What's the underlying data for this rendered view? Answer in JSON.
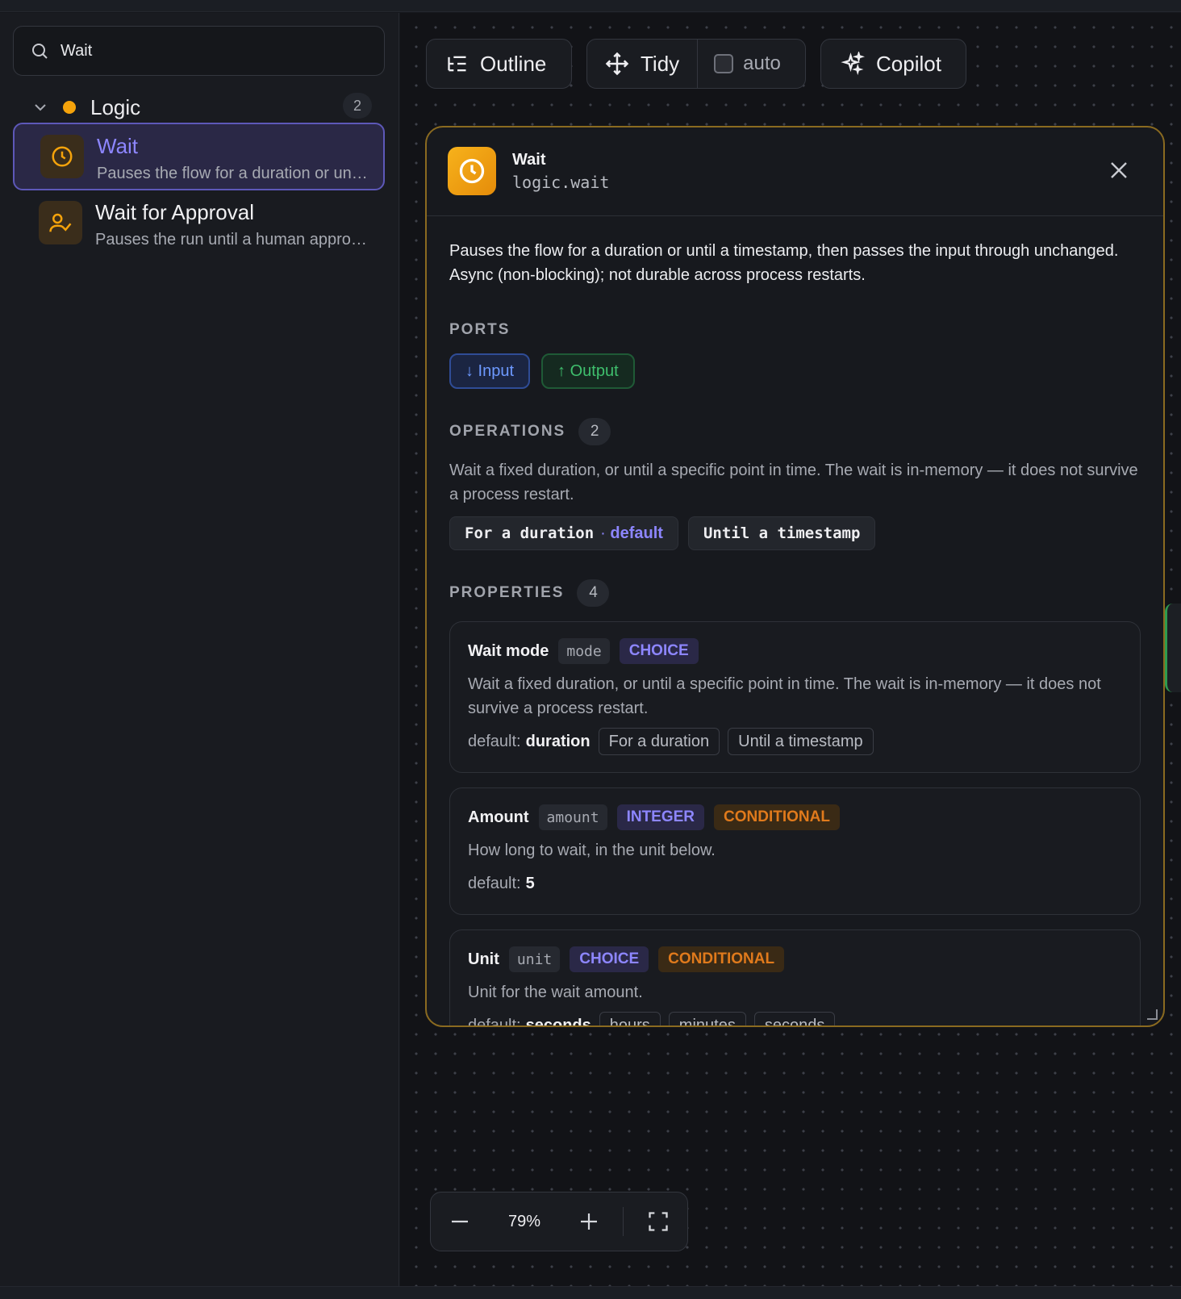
{
  "sidebar": {
    "search": {
      "value": "Wait",
      "placeholder": "Search"
    },
    "group": {
      "name": "Logic",
      "count": "2",
      "dot_color": "#f5a30b"
    },
    "items": [
      {
        "title": "Wait",
        "desc": "Pauses the flow for a duration or unt…",
        "icon": "clock-icon",
        "selected": true
      },
      {
        "title": "Wait for Approval",
        "desc": "Pauses the run until a human approv…",
        "icon": "user-check-icon",
        "selected": false
      }
    ]
  },
  "toolbar": {
    "outline": "Outline",
    "tidy": "Tidy",
    "auto": "auto",
    "copilot": "Copilot"
  },
  "panel": {
    "title": "Wait",
    "subtitle": "logic.wait",
    "description": "Pauses the flow for a duration or until a timestamp, then passes the input through unchanged. Async (non-blocking); not durable across process restarts.",
    "ports_label": "PORTS",
    "ports": {
      "input": "↓ Input",
      "output": "↑ Output"
    },
    "operations_label": "OPERATIONS",
    "operations_count": "2",
    "operations_desc": "Wait a fixed duration, or until a specific point in time. The wait is in-memory — it does not survive a process restart.",
    "operations": [
      {
        "label": "For a duration",
        "default": "default"
      },
      {
        "label": "Until a timestamp"
      }
    ],
    "properties_label": "PROPERTIES",
    "properties_count": "4",
    "properties": [
      {
        "name": "Wait mode",
        "key": "mode",
        "type": "CHOICE",
        "desc": "Wait a fixed duration, or until a specific point in time. The wait is in-memory — it does not survive a process restart.",
        "default_label": "default:",
        "default_value": "duration",
        "options": [
          "For a duration",
          "Until a timestamp"
        ]
      },
      {
        "name": "Amount",
        "key": "amount",
        "type": "INTEGER",
        "conditional": "CONDITIONAL",
        "desc": "How long to wait, in the unit below.",
        "default_label": "default:",
        "default_value": "5"
      },
      {
        "name": "Unit",
        "key": "unit",
        "type": "CHOICE",
        "conditional": "CONDITIONAL",
        "desc": "Unit for the wait amount.",
        "default_label": "default:",
        "default_value": "seconds",
        "options": [
          "hours",
          "minutes",
          "seconds"
        ]
      }
    ]
  },
  "zoom": {
    "value": "79%"
  },
  "colors": {
    "accent": "#8d86ff",
    "warning": "#f5a30b",
    "input": "#6d99ff",
    "output": "#3fbf6d",
    "conditional": "#e07a1c"
  }
}
